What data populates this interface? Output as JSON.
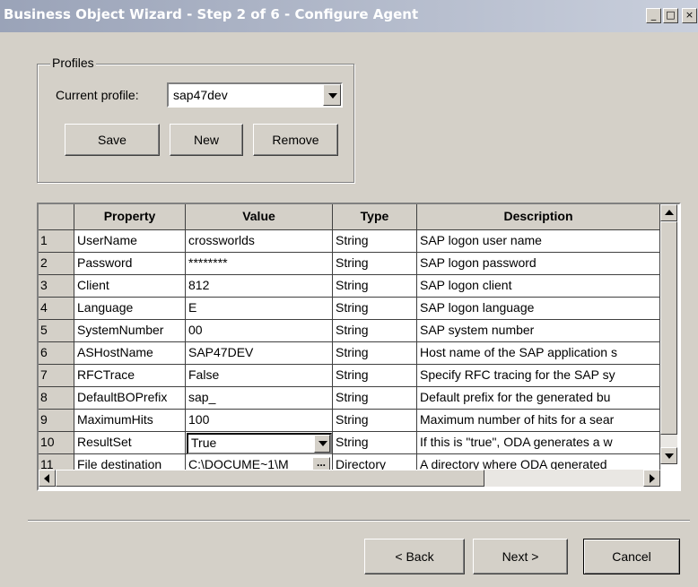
{
  "window": {
    "title": "Business Object Wizard - Step 2 of 6 - Configure Agent",
    "controls": {
      "minimize": "_",
      "maximize": "□",
      "close": "×"
    }
  },
  "profiles": {
    "group_label": "Profiles",
    "current_label": "Current profile:",
    "current_value": "sap47dev",
    "save_label": "Save",
    "new_label": "New",
    "remove_label": "Remove"
  },
  "grid": {
    "headers": {
      "property": "Property",
      "value": "Value",
      "type": "Type",
      "description": "Description"
    },
    "rows": [
      {
        "num": "1",
        "property": "UserName",
        "value": "crossworlds",
        "type": "String",
        "description": "SAP logon user name"
      },
      {
        "num": "2",
        "property": "Password",
        "value": "********",
        "type": "String",
        "description": "SAP logon password"
      },
      {
        "num": "3",
        "property": "Client",
        "value": "812",
        "type": "String",
        "description": "SAP logon client"
      },
      {
        "num": "4",
        "property": "Language",
        "value": "E",
        "type": "String",
        "description": "SAP logon language"
      },
      {
        "num": "5",
        "property": "SystemNumber",
        "value": "00",
        "type": "String",
        "description": "SAP system number"
      },
      {
        "num": "6",
        "property": "ASHostName",
        "value": "SAP47DEV",
        "type": "String",
        "description": "Host name of the SAP application s"
      },
      {
        "num": "7",
        "property": "RFCTrace",
        "value": "False",
        "type": "String",
        "description": "Specify RFC tracing for the SAP sy"
      },
      {
        "num": "8",
        "property": "DefaultBOPrefix",
        "value": "sap_",
        "type": "String",
        "description": "Default prefix for the generated bu"
      },
      {
        "num": "9",
        "property": "MaximumHits",
        "value": "100",
        "type": "String",
        "description": "Maximum number of hits for a sear"
      },
      {
        "num": "10",
        "property": "ResultSet",
        "value": "True",
        "type": "String",
        "description": "If this is \"true\", ODA generates a w"
      },
      {
        "num": "11",
        "property": "File destination",
        "value": "C:\\DOCUME~1\\M",
        "type": "Directory",
        "description": "A directory where ODA generated"
      }
    ],
    "ellipsis": "..."
  },
  "footer": {
    "back_label": "< Back",
    "next_label": "Next >",
    "cancel_label": "Cancel"
  },
  "colors": {
    "face": "#d4d0c8",
    "title_start": "#9aa3b8",
    "title_end": "#c9cfdc"
  }
}
